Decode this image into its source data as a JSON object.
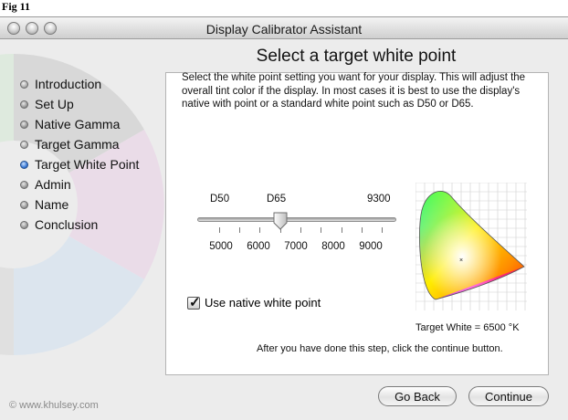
{
  "figure_label": "Fig 11",
  "window": {
    "title": "Display Calibrator Assistant"
  },
  "heading": "Select a target white point",
  "steps": [
    {
      "label": "Introduction",
      "state": "done"
    },
    {
      "label": "Set Up",
      "state": "pending"
    },
    {
      "label": "Native Gamma",
      "state": "pending"
    },
    {
      "label": "Target Gamma",
      "state": "done"
    },
    {
      "label": "Target White Point",
      "state": "current"
    },
    {
      "label": "Admin",
      "state": "pending"
    },
    {
      "label": "Name",
      "state": "pending"
    },
    {
      "label": "Conclusion",
      "state": "pending"
    }
  ],
  "description": "Select the white point setting you want for your display.  This will adjust the overall tint color if the display.  In most cases it is best to use the display's native with point or a standard white point such as D50 or D65.",
  "slider": {
    "preset_labels": [
      "D50",
      "D65",
      "9300"
    ],
    "scale_labels": [
      "5000",
      "6000",
      "7000",
      "8000",
      "9000"
    ],
    "min": 4500,
    "max": 9300,
    "value": 6500
  },
  "native_white_point": {
    "label": "Use native white point",
    "checked": true
  },
  "target_white": "Target White = 6500 °K",
  "continue_hint": "After you have done this step, click the continue button.",
  "buttons": {
    "back": "Go Back",
    "continue": "Continue"
  },
  "watermark": "© www.khulsey.com",
  "colors": {
    "current_step": "#3b7ad6",
    "window_bg": "#ececec",
    "panel_bg": "#ffffff"
  }
}
